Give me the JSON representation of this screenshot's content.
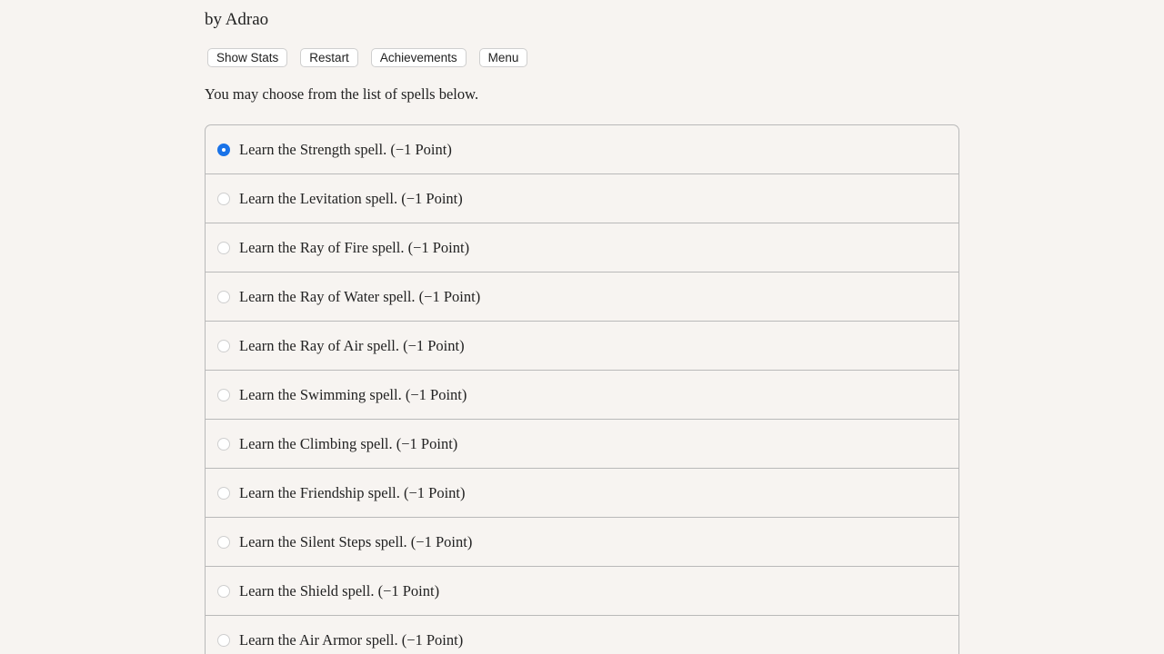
{
  "header": {
    "author": "by Adrao"
  },
  "toolbar": {
    "show_stats_label": "Show Stats",
    "restart_label": "Restart",
    "achievements_label": "Achievements",
    "menu_label": "Menu"
  },
  "prompt": "You may choose from the list of spells below.",
  "choices": [
    {
      "label": "Learn the Strength spell. (−1 Point)",
      "selected": true
    },
    {
      "label": "Learn the Levitation spell. (−1 Point)",
      "selected": false
    },
    {
      "label": "Learn the Ray of Fire spell. (−1 Point)",
      "selected": false
    },
    {
      "label": "Learn the Ray of Water spell. (−1 Point)",
      "selected": false
    },
    {
      "label": "Learn the Ray of Air spell. (−1 Point)",
      "selected": false
    },
    {
      "label": "Learn the Swimming spell. (−1 Point)",
      "selected": false
    },
    {
      "label": "Learn the Climbing spell. (−1 Point)",
      "selected": false
    },
    {
      "label": "Learn the Friendship spell. (−1 Point)",
      "selected": false
    },
    {
      "label": "Learn the Silent Steps spell. (−1 Point)",
      "selected": false
    },
    {
      "label": "Learn the Shield spell. (−1 Point)",
      "selected": false
    },
    {
      "label": "Learn the Air Armor spell. (−1 Point)",
      "selected": false
    }
  ],
  "colors": {
    "background": "#f7f4f1",
    "radio_selected": "#1a73e8",
    "border": "#b9b9b9"
  }
}
